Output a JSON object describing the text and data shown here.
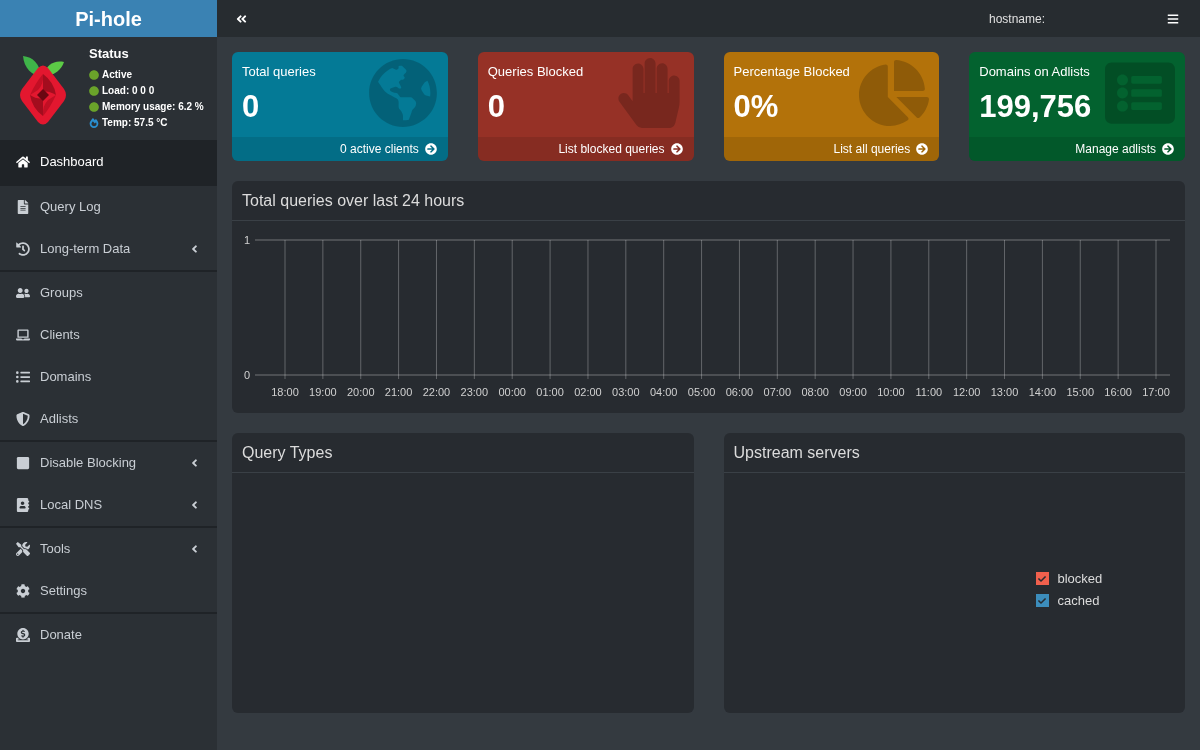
{
  "sidebar": {
    "brand": "Pi-hole",
    "status": {
      "title": "Status",
      "items": [
        {
          "kind": "dot",
          "text": "Active"
        },
        {
          "kind": "dot",
          "text": "Load: 0 0 0"
        },
        {
          "kind": "dot",
          "text": "Memory usage: 6.2 %"
        },
        {
          "kind": "temp",
          "text": "Temp: 57.5 °C"
        }
      ]
    },
    "groups": [
      {
        "items": [
          {
            "label": "Dashboard",
            "selected": true,
            "submenu": false
          }
        ]
      },
      {
        "items": [
          {
            "label": "Query Log",
            "selected": false,
            "submenu": false
          },
          {
            "label": "Long-term Data",
            "selected": false,
            "submenu": true
          }
        ]
      },
      {
        "items": [
          {
            "label": "Groups",
            "selected": false,
            "submenu": false
          },
          {
            "label": "Clients",
            "selected": false,
            "submenu": false
          },
          {
            "label": "Domains",
            "selected": false,
            "submenu": false
          },
          {
            "label": "Adlists",
            "selected": false,
            "submenu": false
          }
        ]
      },
      {
        "items": [
          {
            "label": "Disable Blocking",
            "selected": false,
            "submenu": true
          },
          {
            "label": "Local DNS",
            "selected": false,
            "submenu": true
          }
        ]
      },
      {
        "items": [
          {
            "label": "Tools",
            "selected": false,
            "submenu": true
          },
          {
            "label": "Settings",
            "selected": false,
            "submenu": false
          }
        ]
      },
      {
        "items": [
          {
            "label": "Donate",
            "selected": false,
            "submenu": false
          }
        ]
      }
    ]
  },
  "navbar": {
    "hostname_label": "hostname:"
  },
  "stat_cards": [
    {
      "title": "Total queries",
      "value": "0",
      "link": "0 active clients",
      "color": "#047a96"
    },
    {
      "title": "Queries Blocked",
      "value": "0",
      "link": "List blocked queries",
      "color": "#963126"
    },
    {
      "title": "Percentage Blocked",
      "value": "0%",
      "link": "List all queries",
      "color": "#b3720a"
    },
    {
      "title": "Domains on Adlists",
      "value": "199,756",
      "link": "Manage adlists",
      "color": "#03622f"
    }
  ],
  "queries_chart": {
    "title": "Total queries over last 24 hours",
    "chart_data": {
      "type": "bar",
      "categories": [
        "18:00",
        "19:00",
        "20:00",
        "21:00",
        "22:00",
        "23:00",
        "00:00",
        "01:00",
        "02:00",
        "03:00",
        "04:00",
        "05:00",
        "06:00",
        "07:00",
        "08:00",
        "09:00",
        "10:00",
        "11:00",
        "12:00",
        "13:00",
        "14:00",
        "15:00",
        "16:00",
        "17:00"
      ],
      "values": [
        0,
        0,
        0,
        0,
        0,
        0,
        0,
        0,
        0,
        0,
        0,
        0,
        0,
        0,
        0,
        0,
        0,
        0,
        0,
        0,
        0,
        0,
        0,
        0
      ],
      "ylim": [
        0,
        1
      ],
      "yticks": [
        0,
        1
      ],
      "grid": true
    }
  },
  "query_types": {
    "title": "Query Types"
  },
  "upstream_servers": {
    "title": "Upstream servers",
    "legend": [
      {
        "label": "blocked",
        "color": "#f0604d",
        "checked": true
      },
      {
        "label": "cached",
        "color": "#3c8dbc",
        "checked": true
      }
    ]
  }
}
